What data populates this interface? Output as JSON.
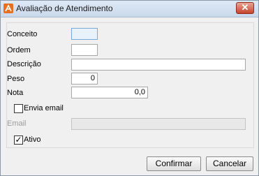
{
  "window": {
    "title": "Avaliação de Atendimento",
    "close_glyph": "✕",
    "icon": "app-icon"
  },
  "form": {
    "conceito": {
      "label": "Conceito",
      "value": ""
    },
    "ordem": {
      "label": "Ordem",
      "value": ""
    },
    "descricao": {
      "label": "Descrição",
      "value": ""
    },
    "peso": {
      "label": "Peso",
      "value": "0"
    },
    "nota": {
      "label": "Nota",
      "value": "0,0"
    },
    "envia_email": {
      "label": "Envia email",
      "checked": false,
      "mark": ""
    },
    "email": {
      "label": "Email",
      "value": "",
      "enabled": false
    },
    "ativo": {
      "label": "Ativo",
      "checked": true,
      "mark": "✓"
    }
  },
  "buttons": {
    "confirmar": "Confirmar",
    "cancelar": "Cancelar"
  },
  "colors": {
    "accent_icon": "#e86f1f",
    "close_button": "#c7432a"
  }
}
